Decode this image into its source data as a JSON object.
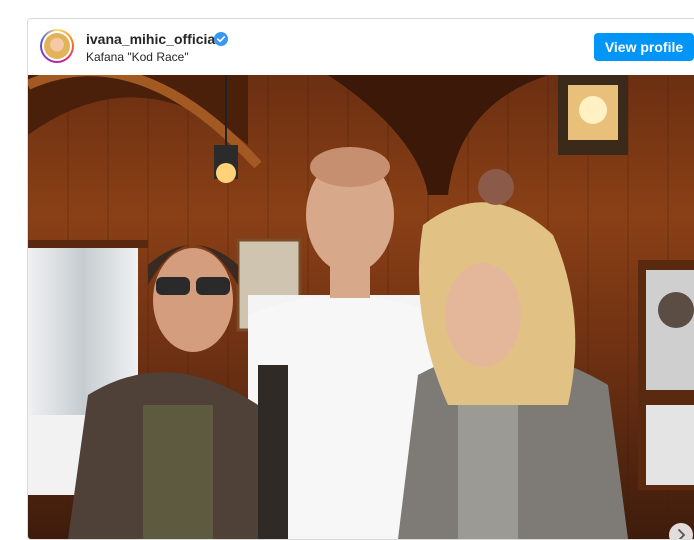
{
  "post": {
    "username": "ivana_mihic_official",
    "location": "Kafana \"Kod Race\"",
    "view_profile_label": "View profile"
  },
  "icons": {
    "verified": "verified-badge-icon",
    "next": "chevron-right-icon"
  },
  "colors": {
    "button": "#0095f6",
    "verified": "#3897f0"
  }
}
